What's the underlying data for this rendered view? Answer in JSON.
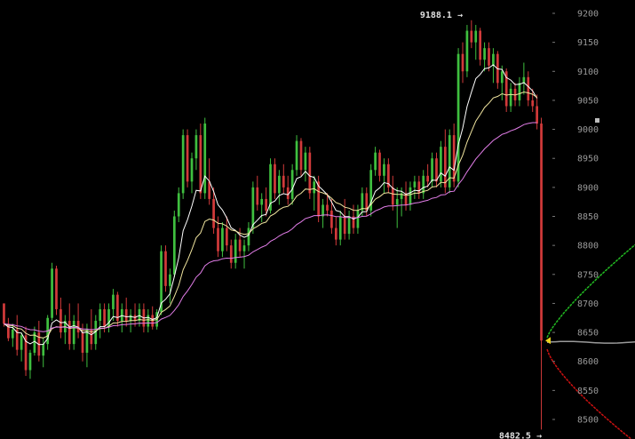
{
  "chart_data": {
    "type": "candlestick",
    "title": "",
    "xlabel": "",
    "ylabel": "",
    "ylim": [
      8470,
      9215
    ],
    "grid": false,
    "background": "#000000",
    "colors": {
      "up": "#3fbf3f",
      "down": "#d23a3a",
      "ema_fast": "#ffffff",
      "ema_mid": "#f2e6a0",
      "ema_slow": "#e27de8",
      "bids": "#22bb22",
      "asks": "#cc1111",
      "depth_mid": "#9a9a9a",
      "price_marker": "#e8d21c"
    },
    "y_ticks": [
      8500,
      8550,
      8600,
      8650,
      8700,
      8750,
      8800,
      8850,
      8900,
      8950,
      9000,
      9050,
      9100,
      9150,
      9200
    ],
    "y_tick_labels": [
      "8500",
      "8550",
      "8600",
      "8650",
      "8700",
      "8750",
      "8800",
      "8850",
      "8900",
      "8950",
      "9000",
      "9050",
      "9100",
      "9150",
      "9200"
    ],
    "annotations": {
      "high_label": "9188.1 →",
      "low_label": "8482.5 →",
      "high": 9188.1,
      "low": 8482.5
    },
    "last_price": 8636,
    "candles": [
      [
        8700,
        8700,
        8660,
        8665
      ],
      [
        8665,
        8675,
        8635,
        8640
      ],
      [
        8640,
        8665,
        8625,
        8655
      ],
      [
        8655,
        8680,
        8610,
        8620
      ],
      [
        8620,
        8650,
        8600,
        8645
      ],
      [
        8645,
        8660,
        8575,
        8585
      ],
      [
        8585,
        8620,
        8570,
        8615
      ],
      [
        8615,
        8660,
        8610,
        8650
      ],
      [
        8650,
        8670,
        8600,
        8610
      ],
      [
        8610,
        8640,
        8590,
        8630
      ],
      [
        8630,
        8680,
        8620,
        8675
      ],
      [
        8675,
        8770,
        8670,
        8760
      ],
      [
        8760,
        8765,
        8680,
        8690
      ],
      [
        8690,
        8710,
        8640,
        8650
      ],
      [
        8650,
        8680,
        8630,
        8670
      ],
      [
        8670,
        8700,
        8620,
        8630
      ],
      [
        8630,
        8680,
        8620,
        8670
      ],
      [
        8670,
        8700,
        8640,
        8650
      ],
      [
        8650,
        8665,
        8600,
        8615
      ],
      [
        8615,
        8665,
        8590,
        8655
      ],
      [
        8655,
        8690,
        8620,
        8630
      ],
      [
        8630,
        8680,
        8620,
        8670
      ],
      [
        8670,
        8700,
        8640,
        8690
      ],
      [
        8690,
        8700,
        8650,
        8660
      ],
      [
        8660,
        8700,
        8650,
        8690
      ],
      [
        8690,
        8725,
        8670,
        8715
      ],
      [
        8715,
        8720,
        8660,
        8670
      ],
      [
        8670,
        8700,
        8650,
        8690
      ],
      [
        8690,
        8710,
        8660,
        8670
      ],
      [
        8670,
        8690,
        8650,
        8680
      ],
      [
        8680,
        8700,
        8660,
        8670
      ],
      [
        8670,
        8700,
        8660,
        8690
      ],
      [
        8690,
        8700,
        8650,
        8660
      ],
      [
        8660,
        8690,
        8650,
        8680
      ],
      [
        8680,
        8695,
        8655,
        8660
      ],
      [
        8660,
        8690,
        8655,
        8685
      ],
      [
        8685,
        8800,
        8680,
        8790
      ],
      [
        8790,
        8800,
        8720,
        8730
      ],
      [
        8730,
        8760,
        8700,
        8750
      ],
      [
        8750,
        8860,
        8745,
        8850
      ],
      [
        8850,
        8900,
        8840,
        8890
      ],
      [
        8890,
        9000,
        8880,
        8990
      ],
      [
        8990,
        9000,
        8900,
        8910
      ],
      [
        8910,
        8960,
        8890,
        8950
      ],
      [
        8950,
        9000,
        8930,
        8990
      ],
      [
        8990,
        9010,
        8880,
        8890
      ],
      [
        8890,
        9020,
        8880,
        9010
      ],
      [
        8910,
        8950,
        8870,
        8880
      ],
      [
        8880,
        8900,
        8820,
        8830
      ],
      [
        8830,
        8850,
        8780,
        8790
      ],
      [
        8790,
        8840,
        8780,
        8830
      ],
      [
        8830,
        8850,
        8790,
        8800
      ],
      [
        8800,
        8810,
        8760,
        8770
      ],
      [
        8770,
        8820,
        8760,
        8810
      ],
      [
        8810,
        8830,
        8780,
        8790
      ],
      [
        8790,
        8810,
        8760,
        8800
      ],
      [
        8800,
        8840,
        8790,
        8830
      ],
      [
        8830,
        8910,
        8820,
        8900
      ],
      [
        8900,
        8920,
        8860,
        8870
      ],
      [
        8870,
        8890,
        8840,
        8880
      ],
      [
        8880,
        8900,
        8850,
        8860
      ],
      [
        8860,
        8950,
        8855,
        8940
      ],
      [
        8940,
        8950,
        8880,
        8890
      ],
      [
        8890,
        8930,
        8870,
        8920
      ],
      [
        8920,
        8940,
        8890,
        8900
      ],
      [
        8900,
        8920,
        8870,
        8880
      ],
      [
        8880,
        8940,
        8870,
        8930
      ],
      [
        8930,
        8990,
        8920,
        8980
      ],
      [
        8980,
        8985,
        8920,
        8930
      ],
      [
        8930,
        8970,
        8910,
        8960
      ],
      [
        8960,
        8970,
        8880,
        8890
      ],
      [
        8890,
        8920,
        8860,
        8910
      ],
      [
        8910,
        8920,
        8840,
        8850
      ],
      [
        8850,
        8880,
        8830,
        8870
      ],
      [
        8870,
        8890,
        8850,
        8860
      ],
      [
        8860,
        8880,
        8820,
        8830
      ],
      [
        8830,
        8850,
        8800,
        8810
      ],
      [
        8810,
        8860,
        8800,
        8850
      ],
      [
        8850,
        8880,
        8810,
        8820
      ],
      [
        8820,
        8860,
        8810,
        8850
      ],
      [
        8850,
        8870,
        8820,
        8830
      ],
      [
        8830,
        8870,
        8820,
        8860
      ],
      [
        8860,
        8900,
        8850,
        8890
      ],
      [
        8890,
        8900,
        8850,
        8860
      ],
      [
        8860,
        8940,
        8850,
        8930
      ],
      [
        8930,
        8970,
        8920,
        8960
      ],
      [
        8960,
        8965,
        8910,
        8920
      ],
      [
        8920,
        8950,
        8890,
        8940
      ],
      [
        8940,
        8950,
        8890,
        8900
      ],
      [
        8900,
        8920,
        8860,
        8870
      ],
      [
        8870,
        8900,
        8830,
        8880
      ],
      [
        8880,
        8900,
        8850,
        8890
      ],
      [
        8890,
        8910,
        8860,
        8870
      ],
      [
        8870,
        8910,
        8860,
        8900
      ],
      [
        8900,
        8920,
        8880,
        8910
      ],
      [
        8910,
        8920,
        8880,
        8890
      ],
      [
        8890,
        8930,
        8880,
        8920
      ],
      [
        8920,
        8940,
        8900,
        8910
      ],
      [
        8910,
        8960,
        8900,
        8950
      ],
      [
        8950,
        8960,
        8900,
        8910
      ],
      [
        8910,
        8980,
        8900,
        8970
      ],
      [
        8970,
        9000,
        8890,
        8900
      ],
      [
        8900,
        9000,
        8890,
        8990
      ],
      [
        8990,
        9010,
        8900,
        8910
      ],
      [
        8910,
        9140,
        8900,
        9130
      ],
      [
        9130,
        9150,
        9080,
        9100
      ],
      [
        9100,
        9180,
        9090,
        9170
      ],
      [
        9170,
        9188.1,
        9140,
        9150
      ],
      [
        9150,
        9180,
        9120,
        9170
      ],
      [
        9170,
        9175,
        9110,
        9120
      ],
      [
        9120,
        9150,
        9100,
        9140
      ],
      [
        9140,
        9150,
        9100,
        9110
      ],
      [
        9110,
        9140,
        9080,
        9130
      ],
      [
        9130,
        9135,
        9070,
        9080
      ],
      [
        9080,
        9110,
        9050,
        9100
      ],
      [
        9100,
        9105,
        9030,
        9040
      ],
      [
        9040,
        9080,
        9030,
        9070
      ],
      [
        9070,
        9080,
        9040,
        9050
      ],
      [
        9050,
        9090,
        9040,
        9080
      ],
      [
        9080,
        9115,
        9060,
        9090
      ],
      [
        9090,
        9100,
        9040,
        9050
      ],
      [
        9050,
        9070,
        9030,
        9040
      ],
      [
        9040,
        9060,
        9000,
        9010
      ],
      [
        9010,
        9020,
        8482.5,
        8636
      ]
    ]
  }
}
